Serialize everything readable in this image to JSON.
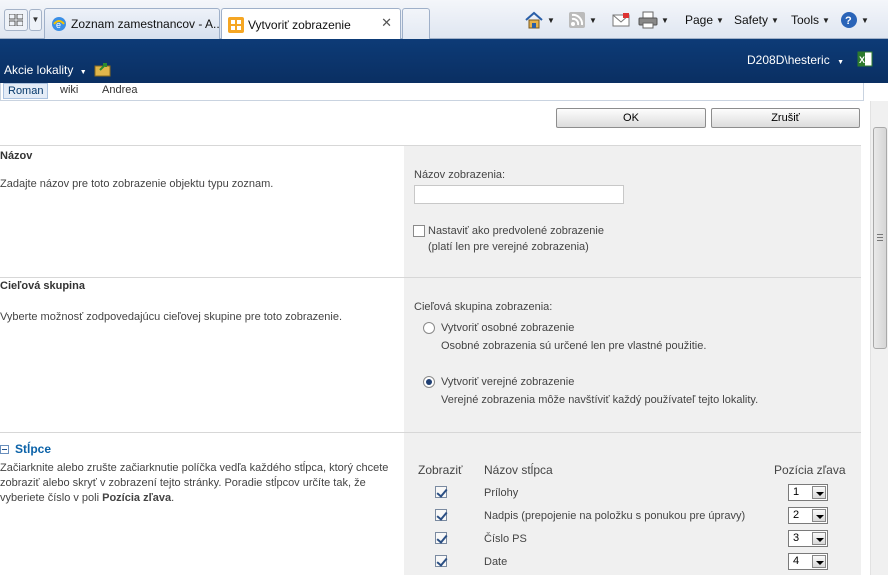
{
  "browser": {
    "tabs": [
      {
        "title": "Zoznam zamestnancov - A...",
        "active": false
      },
      {
        "title": "Vytvoriť zobrazenie",
        "active": true
      }
    ],
    "commands": {
      "page": "Page",
      "safety": "Safety",
      "tools": "Tools"
    }
  },
  "header": {
    "site_actions": "Akcie lokality",
    "user": "D208D\\hesteric"
  },
  "nav": {
    "items": [
      "Roman",
      "wiki",
      "Andrea"
    ],
    "selected": "Roman"
  },
  "toolbar": {
    "ok": "OK",
    "cancel": "Zrušiť"
  },
  "name_section": {
    "title": "Názov",
    "description": "Zadajte názov pre toto zobrazenie objektu typu zoznam.",
    "field_label": "Názov zobrazenia:",
    "field_value": "",
    "default_checkbox_label": "Nastaviť ako predvolené zobrazenie",
    "default_checkbox_note": "(platí len pre verejné zobrazenia)",
    "default_checked": false
  },
  "audience_section": {
    "title": "Cieľová skupina",
    "description": "Vyberte možnosť zodpovedajúcu cieľovej skupine pre toto zobrazenie.",
    "field_label": "Cieľová skupina zobrazenia:",
    "options": [
      {
        "label": "Vytvoriť osobné zobrazenie",
        "note": "Osobné zobrazenia sú určené len pre vlastné použitie.",
        "selected": false
      },
      {
        "label": "Vytvoriť verejné zobrazenie",
        "note": "Verejné zobrazenia môže navštíviť každý používateľ tejto lokality.",
        "selected": true
      }
    ]
  },
  "columns_section": {
    "title": "Stĺpce",
    "description_line1": "Začiarknite alebo zrušte začiarknutie políčka vedľa každého stĺpca, ktorý chcete",
    "description_line2": "zobraziť alebo skryť v zobrazení tejto stránky. Poradie stĺpcov určíte tak, že",
    "description_line3_prefix": "vyberiete číslo v poli ",
    "description_line3_bold": "Pozícia zľava",
    "description_line3_suffix": ".",
    "headers": {
      "show": "Zobraziť",
      "name": "Názov stĺpca",
      "position": "Pozícia zľava"
    },
    "rows": [
      {
        "name": "Prílohy",
        "checked": true,
        "position": "1"
      },
      {
        "name": "Nadpis (prepojenie na položku s ponukou pre úpravy)",
        "checked": true,
        "position": "2"
      },
      {
        "name": "Číslo PS",
        "checked": true,
        "position": "3"
      },
      {
        "name": "Date",
        "checked": true,
        "position": "4"
      }
    ]
  }
}
